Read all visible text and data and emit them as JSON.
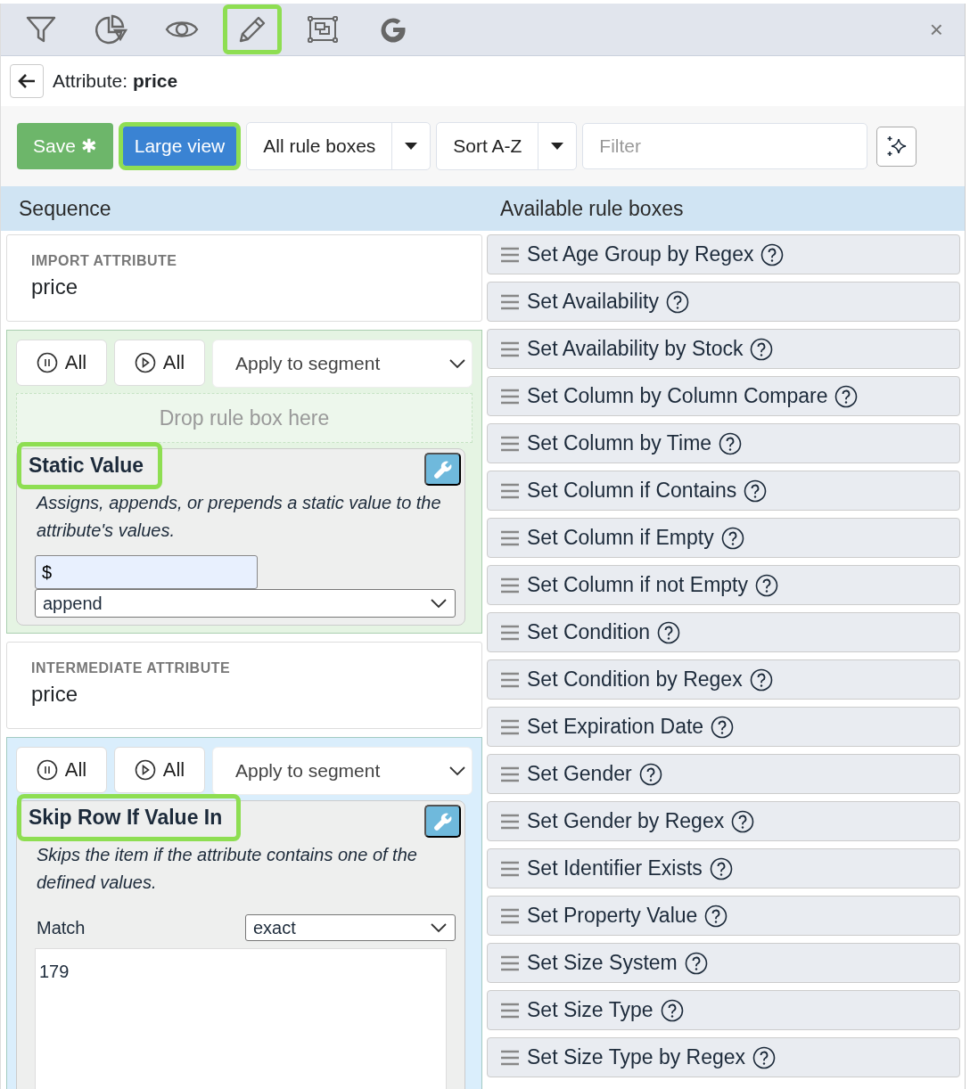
{
  "toolbar": {
    "tools": [
      {
        "kind": "filter",
        "highlighted": false
      },
      {
        "kind": "chart",
        "highlighted": false
      },
      {
        "kind": "eye",
        "highlighted": false
      },
      {
        "kind": "pencil",
        "highlighted": true
      },
      {
        "kind": "frame",
        "highlighted": false
      },
      {
        "kind": "google",
        "highlighted": false
      }
    ],
    "close": "×"
  },
  "header": {
    "title": "Attribute: **price**"
  },
  "actions": {
    "save": "Save ✱",
    "large_view": {
      "label": "Large view",
      "highlighted": true
    },
    "dropdowns": [
      "All rule boxes",
      "Sort A-Z"
    ],
    "filter": {
      "placeholder": "Filter"
    }
  },
  "columns": [
    "Sequence",
    "Available rule boxes"
  ],
  "sequence": [
    {
      "kind": "attribute",
      "label": "IMPORT ATTRIBUTE",
      "value": "price"
    },
    {
      "kind": "segment",
      "color": "#e5f4e3",
      "pause": "All",
      "play": "All",
      "segment_select": "Apply to segment",
      "drop_zone": "Drop rule box here",
      "rule": {
        "title": "Static Value",
        "highlighted": true,
        "description": "Assigns, appends, or prepends a static value to the attribute's values.",
        "fields": [
          {
            "kind": "input",
            "value": "$"
          },
          {
            "kind": "select",
            "value": "append"
          }
        ]
      }
    },
    {
      "kind": "attribute",
      "label": "INTERMEDIATE ATTRIBUTE",
      "value": "price"
    },
    {
      "kind": "segment",
      "color": "#daeefc",
      "pause": "All",
      "play": "All",
      "segment_select": "Apply to segment",
      "rule": {
        "title": "Skip Row If Value In",
        "highlighted": true,
        "description": "Skips the item if the attribute contains one of the defined values.",
        "fields": [
          {
            "kind": "labeled_select",
            "label": "Match",
            "value": "exact"
          },
          {
            "kind": "textarea",
            "value": "179"
          }
        ]
      }
    }
  ],
  "available": [
    "Set Age Group by Regex",
    "Set Availability",
    "Set Availability by Stock",
    "Set Column by Column Compare",
    "Set Column by Time",
    "Set Column if Contains",
    "Set Column if Empty",
    "Set Column if not Empty",
    "Set Condition",
    "Set Condition by Regex",
    "Set Expiration Date",
    "Set Gender",
    "Set Gender by Regex",
    "Set Identifier Exists",
    "Set Property Value",
    "Set Size System",
    "Set Size Type",
    "Set Size Type by Regex"
  ]
}
